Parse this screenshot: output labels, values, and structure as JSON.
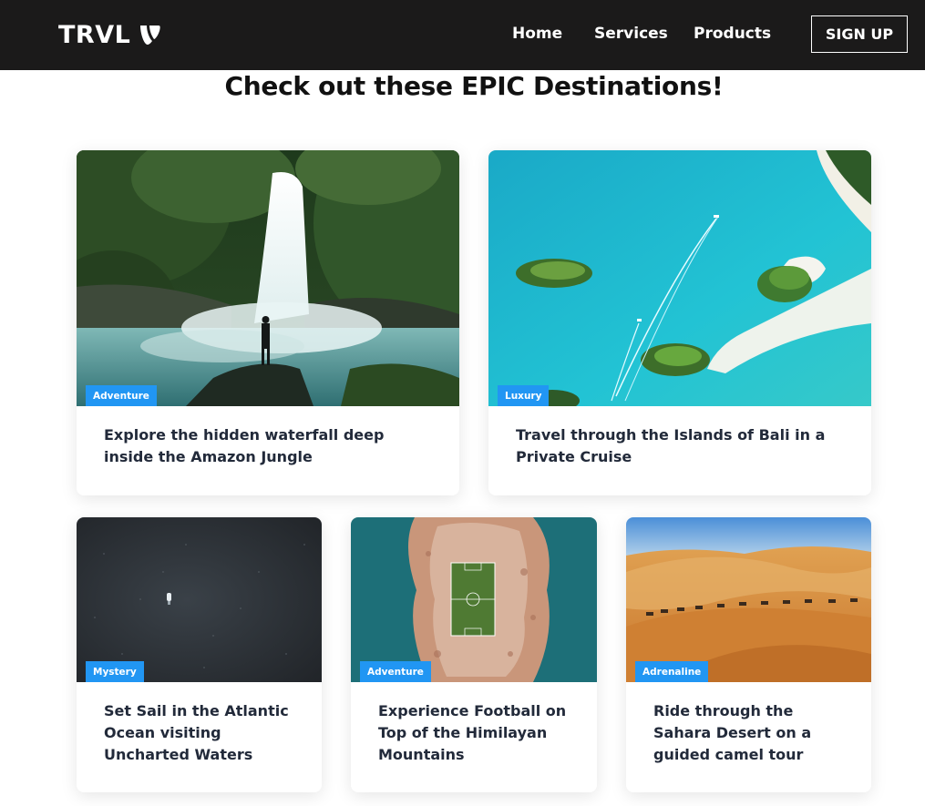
{
  "brand": {
    "name": "TRVL",
    "logo_icon": "typo3-logo-icon"
  },
  "nav": {
    "links": [
      "Home",
      "Services",
      "Products"
    ],
    "signup_label": "SIGN UP"
  },
  "main": {
    "heading": "Check out these EPIC Destinations!",
    "cards": [
      {
        "category": "Adventure",
        "title": "Explore the hidden waterfall deep inside the Amazon Jungle",
        "image": "waterfall-jungle"
      },
      {
        "category": "Luxury",
        "title": "Travel through the Islands of Bali in a Private Cruise",
        "image": "bali-islands-aerial"
      },
      {
        "category": "Mystery",
        "title": "Set Sail in the Atlantic Ocean visiting Uncharted Waters",
        "image": "dark-ocean-boat"
      },
      {
        "category": "Adventure",
        "title": "Experience Football on Top of the Himilayan Mountains",
        "image": "island-football-pitch"
      },
      {
        "category": "Adrenaline",
        "title": "Ride through the Sahara Desert on a guided camel tour",
        "image": "sahara-camel-caravan"
      }
    ]
  },
  "colors": {
    "navbar": "#1b1a1a",
    "badge": "#2196f3",
    "title_text": "#222a3a"
  }
}
